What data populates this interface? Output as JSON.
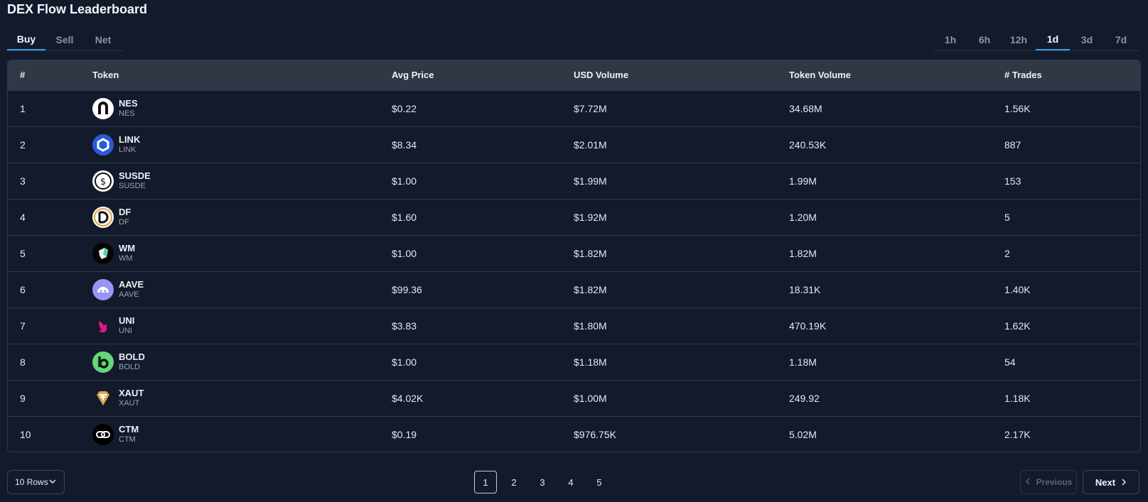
{
  "header": {
    "title": "DEX Flow Leaderboard"
  },
  "side_tabs": [
    {
      "label": "Buy",
      "active": true
    },
    {
      "label": "Sell",
      "active": false
    },
    {
      "label": "Net",
      "active": false
    }
  ],
  "time_tabs": [
    {
      "label": "1h",
      "active": false
    },
    {
      "label": "6h",
      "active": false
    },
    {
      "label": "12h",
      "active": false
    },
    {
      "label": "1d",
      "active": true
    },
    {
      "label": "3d",
      "active": false
    },
    {
      "label": "7d",
      "active": false
    }
  ],
  "table": {
    "columns": [
      "#",
      "Token",
      "Avg Price",
      "USD Volume",
      "Token Volume",
      "# Trades"
    ],
    "rows": [
      {
        "rank": "1",
        "name": "NES",
        "symbol": "NES",
        "icon": "nes-token-icon",
        "avg_price": "$0.22",
        "usd_volume": "$7.72M",
        "token_volume": "34.68M",
        "trades": "1.56K"
      },
      {
        "rank": "2",
        "name": "LINK",
        "symbol": "LINK",
        "icon": "link-token-icon",
        "avg_price": "$8.34",
        "usd_volume": "$2.01M",
        "token_volume": "240.53K",
        "trades": "887"
      },
      {
        "rank": "3",
        "name": "SUSDE",
        "symbol": "SUSDE",
        "icon": "susde-token-icon",
        "avg_price": "$1.00",
        "usd_volume": "$1.99M",
        "token_volume": "1.99M",
        "trades": "153"
      },
      {
        "rank": "4",
        "name": "DF",
        "symbol": "DF",
        "icon": "df-token-icon",
        "avg_price": "$1.60",
        "usd_volume": "$1.92M",
        "token_volume": "1.20M",
        "trades": "5"
      },
      {
        "rank": "5",
        "name": "WM",
        "symbol": "WM",
        "icon": "wm-token-icon",
        "avg_price": "$1.00",
        "usd_volume": "$1.82M",
        "token_volume": "1.82M",
        "trades": "2"
      },
      {
        "rank": "6",
        "name": "AAVE",
        "symbol": "AAVE",
        "icon": "aave-token-icon",
        "avg_price": "$99.36",
        "usd_volume": "$1.82M",
        "token_volume": "18.31K",
        "trades": "1.40K"
      },
      {
        "rank": "7",
        "name": "UNI",
        "symbol": "UNI",
        "icon": "uni-token-icon",
        "avg_price": "$3.83",
        "usd_volume": "$1.80M",
        "token_volume": "470.19K",
        "trades": "1.62K"
      },
      {
        "rank": "8",
        "name": "BOLD",
        "symbol": "BOLD",
        "icon": "bold-token-icon",
        "avg_price": "$1.00",
        "usd_volume": "$1.18M",
        "token_volume": "1.18M",
        "trades": "54"
      },
      {
        "rank": "9",
        "name": "XAUT",
        "symbol": "XAUT",
        "icon": "xaut-token-icon",
        "avg_price": "$4.02K",
        "usd_volume": "$1.00M",
        "token_volume": "249.92",
        "trades": "1.18K"
      },
      {
        "rank": "10",
        "name": "CTM",
        "symbol": "CTM",
        "icon": "ctm-token-icon",
        "avg_price": "$0.19",
        "usd_volume": "$976.75K",
        "token_volume": "5.02M",
        "trades": "2.17K"
      }
    ]
  },
  "footer": {
    "rows_select": "10 Rows",
    "pages": [
      "1",
      "2",
      "3",
      "4",
      "5"
    ],
    "current_page": "1",
    "prev_label": "Previous",
    "next_label": "Next"
  },
  "colors": {
    "background": "#131a2b",
    "header_row": "#313845",
    "accent": "#3aa0e8"
  }
}
